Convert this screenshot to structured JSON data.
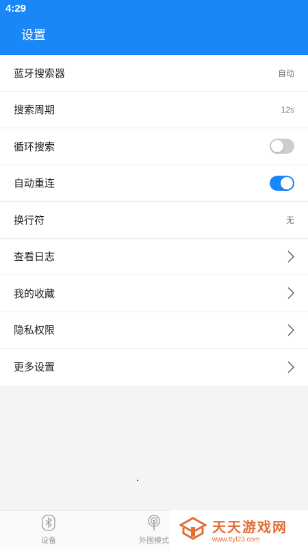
{
  "status_bar": {
    "time": "4:29"
  },
  "header": {
    "title": "设置"
  },
  "settings": {
    "bluetooth_searcher": {
      "label": "蓝牙搜索器",
      "value": "自动"
    },
    "search_period": {
      "label": "搜索周期",
      "value": "12s"
    },
    "loop_search": {
      "label": "循环搜索",
      "toggle": false
    },
    "auto_reconnect": {
      "label": "自动重连",
      "toggle": true
    },
    "line_break": {
      "label": "换行符",
      "value": "无"
    },
    "view_logs": {
      "label": "查看日志"
    },
    "my_favorites": {
      "label": "我的收藏"
    },
    "privacy": {
      "label": "隐私权限"
    },
    "more_settings": {
      "label": "更多设置"
    }
  },
  "bottom_nav": {
    "devices": {
      "label": "设备",
      "icon": "bluetooth-icon"
    },
    "peripheral_mode": {
      "label": "外围模式",
      "icon": "broadcast-icon"
    }
  },
  "watermark": {
    "line1": "天天游戏网",
    "line2": "www.ttyl23.com"
  },
  "colors": {
    "accent": "#1a87f8",
    "toggle_off": "#cccccc",
    "watermark": "#e56c33"
  }
}
